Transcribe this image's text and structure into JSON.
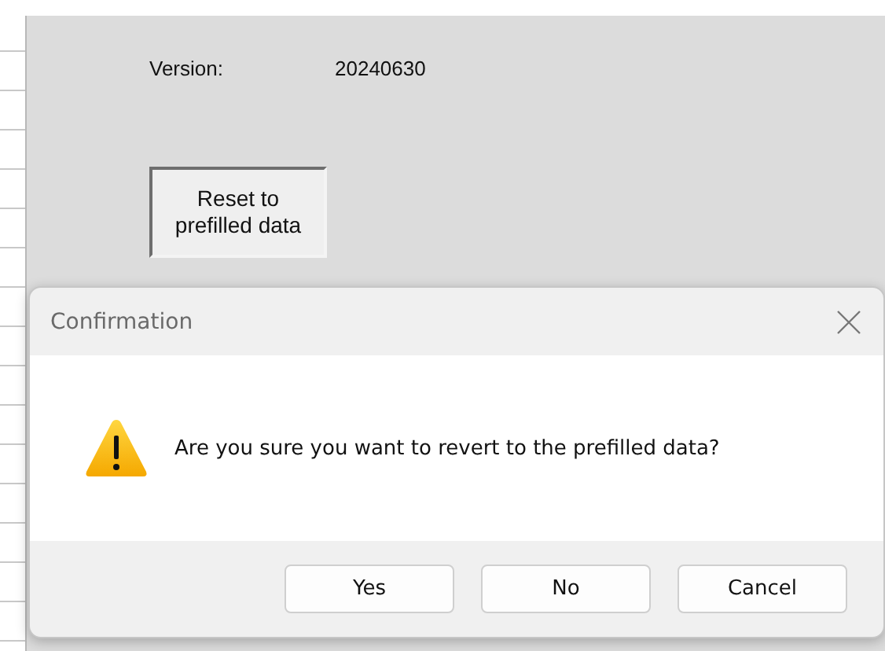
{
  "panel": {
    "version_label": "Version:",
    "version_value": "20240630",
    "reset_button": "Reset to\nprefilled data"
  },
  "dialog": {
    "title": "Confirmation",
    "message": "Are you sure you want to revert to the prefilled data?",
    "buttons": [
      {
        "label": "Yes"
      },
      {
        "label": "No"
      },
      {
        "label": "Cancel"
      }
    ]
  }
}
